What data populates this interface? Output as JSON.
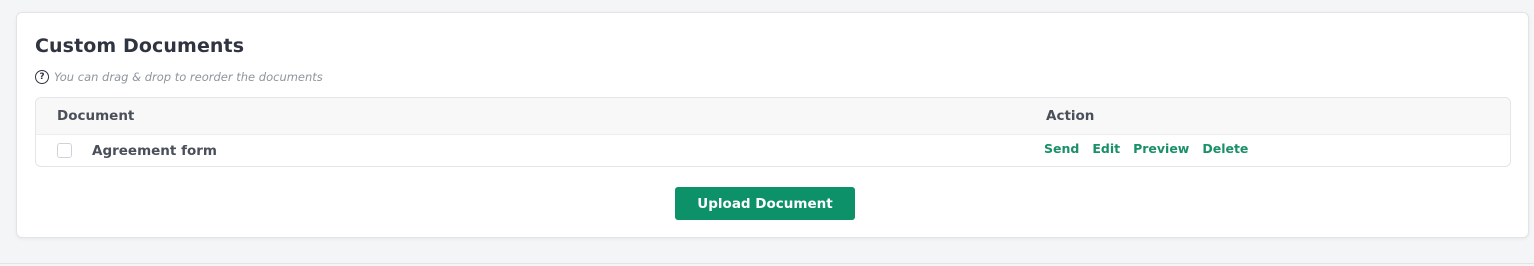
{
  "section": {
    "title": "Custom Documents",
    "hint_icon": "?",
    "hint_text": "You can drag & drop to reorder the documents"
  },
  "table": {
    "headers": {
      "document": "Document",
      "action": "Action"
    },
    "rows": [
      {
        "name": "Agreement form",
        "checked": false,
        "actions": [
          "Send",
          "Edit",
          "Preview",
          "Delete"
        ]
      }
    ]
  },
  "upload_button": {
    "label": "Upload Document"
  },
  "colors": {
    "accent": "#0d9168",
    "link": "#1a9068",
    "title": "#2f3440",
    "hint": "#8f959e"
  }
}
